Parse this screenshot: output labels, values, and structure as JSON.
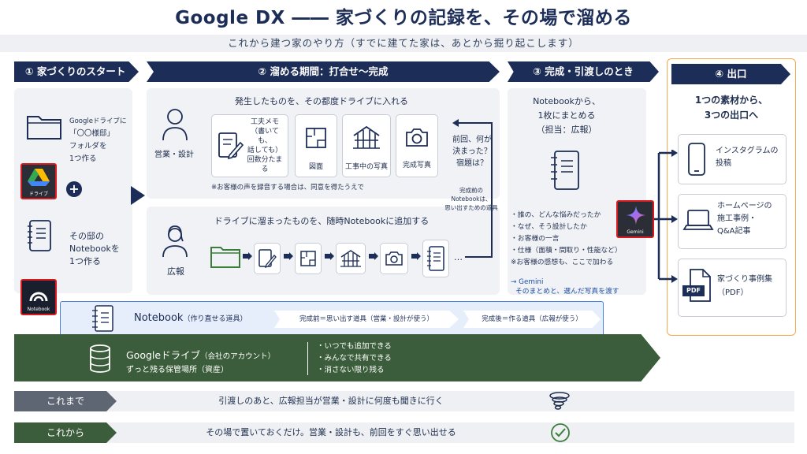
{
  "title": "Google DX ―― 家づくりの記録を、その場で溜める",
  "subtitle": "これから建つ家のやり方（すでに建てた家は、あとから掘り起こします）",
  "colors": {
    "navy": "#1c2d57",
    "panel": "#f1f2f5",
    "green": "#3b5d3b",
    "orange": "#f4a94a",
    "red": "#d8191e"
  },
  "steps": [
    {
      "label": "① 家づくりのスタート"
    },
    {
      "label": "② 溜める期間：打合せ〜完成"
    },
    {
      "label": "③ 完成・引渡しのとき"
    },
    {
      "label": "④ 出口"
    }
  ],
  "step1": {
    "folder_text": [
      "Googleドライブに",
      "「〇〇様邸」",
      "フォルダを",
      "1つ作る"
    ],
    "drive_app_label": "ドライブ",
    "plus": "+",
    "notebook_text": [
      "その邸の",
      "Notebookを",
      "1つ作る"
    ],
    "notebook_app_label": "Notebook"
  },
  "step2": {
    "top_title": "発生したものを、その都度ドライブに入れる",
    "role_sales": "営業・設計",
    "items": [
      {
        "icon": "memo-icon",
        "label": [
          "工夫メモ",
          "（書いても、",
          "話しても）",
          "回数分たまる"
        ]
      },
      {
        "icon": "floorplan-icon",
        "label": [
          "図面"
        ]
      },
      {
        "icon": "construction-photo-icon",
        "label": [
          "工事中の写真"
        ]
      },
      {
        "icon": "camera-icon",
        "label": [
          "完成写真"
        ]
      }
    ],
    "note": "※お客様の声を録音する場合は、同意を得たうえで",
    "question": [
      "前回、何が",
      "決まった？",
      "宿題は？"
    ],
    "question_note": [
      "完成前の",
      "Notebookは、",
      "思い出すための道具"
    ],
    "bottom_title": "ドライブに溜まったものを、随時Notebookに追加する",
    "role_pr": "広報",
    "ellipsis": "…"
  },
  "step3": {
    "title": [
      "Notebookから、",
      "1枚にまとめる",
      "（担当：広報）"
    ],
    "bullets": [
      "・誰の、どんな悩みだったか",
      "・なぜ、そう設計したか",
      "・お客様の一言",
      "・仕様（面積・間取り・性能など）"
    ],
    "note": "※お客様の感想も、ここで加わる",
    "gemini_note": [
      "→ Gemini",
      "そのまとめと、選んだ写真を渡す"
    ],
    "gemini_app_label": "Gemini"
  },
  "step4": {
    "title": [
      "1つの素材から、",
      "3つの出口へ"
    ],
    "outputs": [
      {
        "icon": "smartphone-icon",
        "label": [
          "インスタグラムの",
          "投稿"
        ]
      },
      {
        "icon": "laptop-icon",
        "label": [
          "ホームページの",
          "施工事例・",
          "Q&A記事"
        ]
      },
      {
        "icon": "pdf-icon",
        "label": [
          "家づくり事例集",
          "（PDF）"
        ],
        "badge": "PDF"
      }
    ]
  },
  "notebook_bar": {
    "title": "Notebook",
    "sub": "（作り直せる道具）",
    "phase1": "完成前＝思い出す道具（営業・設計が使う）",
    "phase2": "完成後＝作る道具（広報が使う）"
  },
  "drive_bar": {
    "title": "Googleドライブ",
    "title_sub": "（会社のアカウント）",
    "sub": "ずっと残る保管場所（資産）",
    "points": [
      "・いつでも追加できる",
      "・みんなで共有できる",
      "・消さない限り残る"
    ]
  },
  "compare": {
    "before_label": "これまで",
    "before_text": "引渡しのあと、広報担当が営業・設計に何度も聞きに行く",
    "after_label": "これから",
    "after_text": "その場で置いておくだけ。営業・設計も、前回をすぐ思い出せる"
  }
}
